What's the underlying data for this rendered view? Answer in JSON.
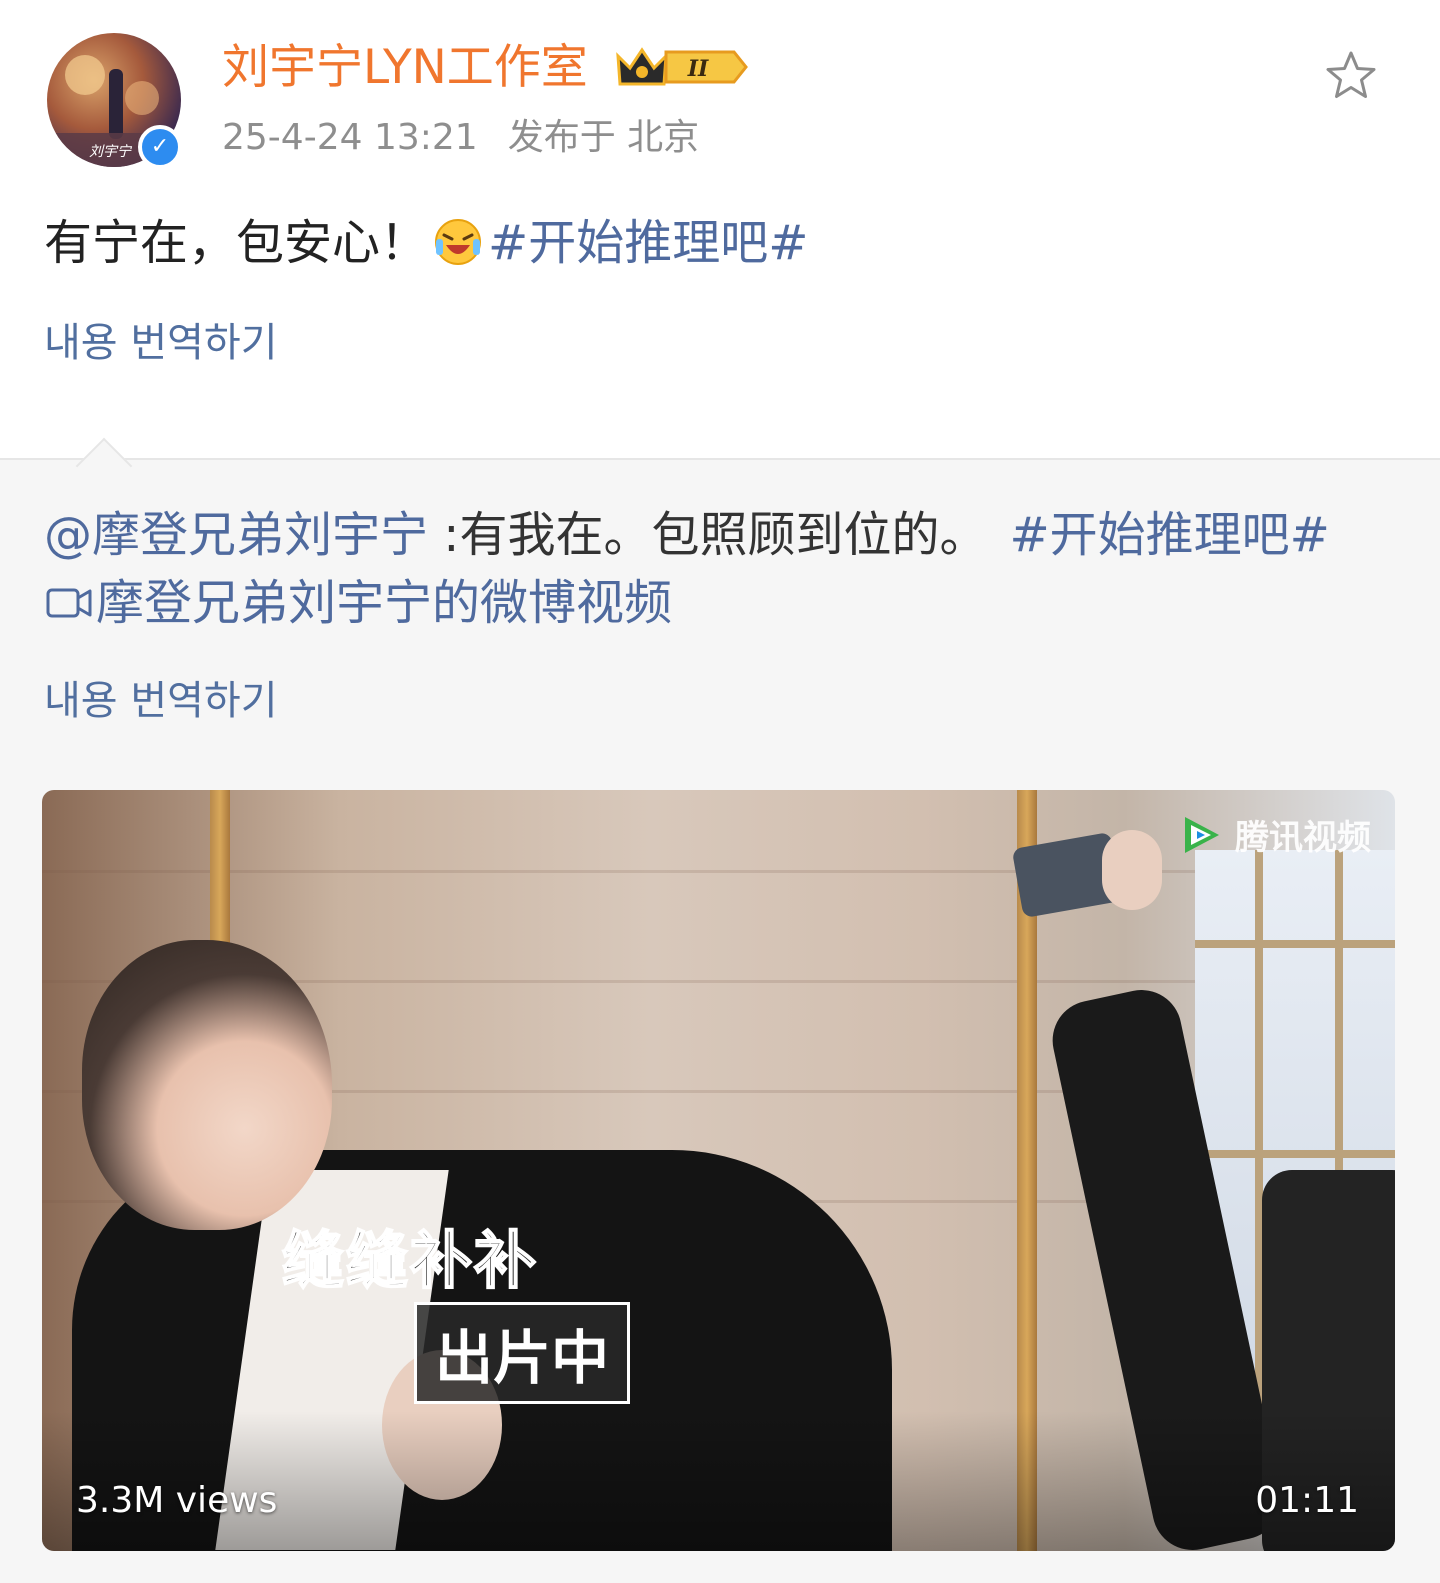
{
  "post": {
    "author": "刘宇宁LYN工作室",
    "member_level": "II",
    "timestamp": "25-4-24 13:21",
    "location": "发布于 北京",
    "text_prefix": "有宁在，包安心！",
    "emoji": "laughing-face-emoji",
    "hashtag": "#开始推理吧#",
    "translate_label": "내용 번역하기"
  },
  "repost": {
    "mention": "@摩登兄弟刘宇宁",
    "text": " :有我在。包照顾到位的。",
    "hashtag": "#开始推理吧#",
    "video_link": "摩登兄弟刘宇宁的微博视频",
    "translate_label": "내용 번역하기"
  },
  "video": {
    "watermark": "腾讯视频",
    "overlay_caption_1": "缝缝补补",
    "overlay_caption_2": "出片中",
    "views": "3.3M views",
    "duration": "01:11"
  },
  "colors": {
    "author": "#f0762e",
    "link": "#4f6a9e",
    "translate": "#516f9f",
    "timestamp": "#8e8e8e",
    "verified": "#2d8cf0",
    "repost_bg": "#f6f6f6"
  },
  "icons": [
    "verified-icon",
    "crown-badge-icon",
    "favorite-star-icon",
    "video-camera-icon",
    "tencent-video-icon"
  ]
}
